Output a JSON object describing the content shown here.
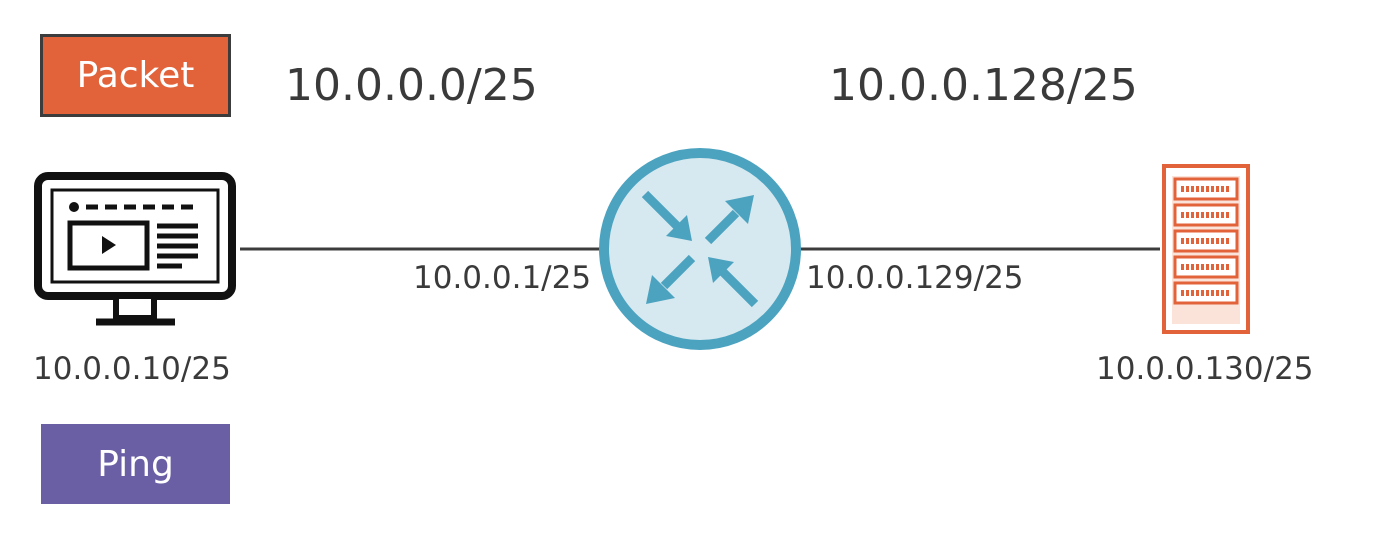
{
  "colors": {
    "packet": "#e2623a",
    "ping": "#6a5ea5",
    "router_fill": "#d7e9f0",
    "router_stroke": "#4ca3c0",
    "server": "#e2623a",
    "line": "#3c3c3c"
  },
  "badges": {
    "packet": "Packet",
    "ping": "Ping"
  },
  "subnets": {
    "left": "10.0.0.0/25",
    "right": "10.0.0.128/25"
  },
  "interfaces": {
    "router_left": "10.0.0.1/25",
    "router_right": "10.0.0.129/25"
  },
  "hosts": {
    "pc": {
      "icon": "desktop-monitor-icon",
      "ip": "10.0.0.10/25"
    },
    "server": {
      "icon": "server-rack-icon",
      "ip": "10.0.0.130/25"
    }
  },
  "router": {
    "icon": "router-icon"
  }
}
